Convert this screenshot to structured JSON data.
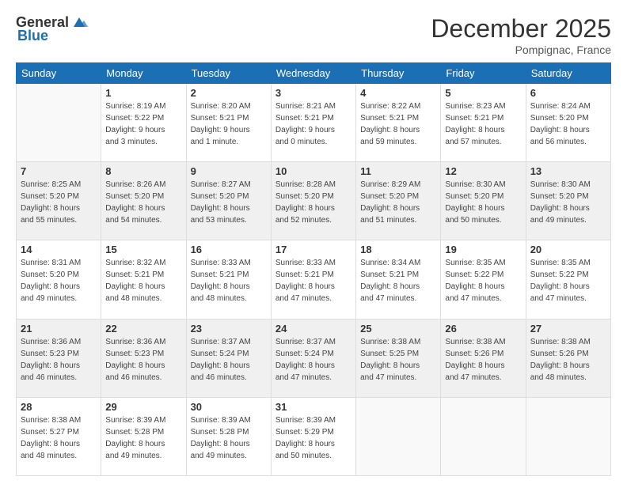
{
  "header": {
    "logo_general": "General",
    "logo_blue": "Blue",
    "month_title": "December 2025",
    "location": "Pompignac, France"
  },
  "days_of_week": [
    "Sunday",
    "Monday",
    "Tuesday",
    "Wednesday",
    "Thursday",
    "Friday",
    "Saturday"
  ],
  "weeks": [
    [
      {
        "day": "",
        "info": ""
      },
      {
        "day": "1",
        "info": "Sunrise: 8:19 AM\nSunset: 5:22 PM\nDaylight: 9 hours\nand 3 minutes."
      },
      {
        "day": "2",
        "info": "Sunrise: 8:20 AM\nSunset: 5:21 PM\nDaylight: 9 hours\nand 1 minute."
      },
      {
        "day": "3",
        "info": "Sunrise: 8:21 AM\nSunset: 5:21 PM\nDaylight: 9 hours\nand 0 minutes."
      },
      {
        "day": "4",
        "info": "Sunrise: 8:22 AM\nSunset: 5:21 PM\nDaylight: 8 hours\nand 59 minutes."
      },
      {
        "day": "5",
        "info": "Sunrise: 8:23 AM\nSunset: 5:21 PM\nDaylight: 8 hours\nand 57 minutes."
      },
      {
        "day": "6",
        "info": "Sunrise: 8:24 AM\nSunset: 5:20 PM\nDaylight: 8 hours\nand 56 minutes."
      }
    ],
    [
      {
        "day": "7",
        "info": "Sunrise: 8:25 AM\nSunset: 5:20 PM\nDaylight: 8 hours\nand 55 minutes."
      },
      {
        "day": "8",
        "info": "Sunrise: 8:26 AM\nSunset: 5:20 PM\nDaylight: 8 hours\nand 54 minutes."
      },
      {
        "day": "9",
        "info": "Sunrise: 8:27 AM\nSunset: 5:20 PM\nDaylight: 8 hours\nand 53 minutes."
      },
      {
        "day": "10",
        "info": "Sunrise: 8:28 AM\nSunset: 5:20 PM\nDaylight: 8 hours\nand 52 minutes."
      },
      {
        "day": "11",
        "info": "Sunrise: 8:29 AM\nSunset: 5:20 PM\nDaylight: 8 hours\nand 51 minutes."
      },
      {
        "day": "12",
        "info": "Sunrise: 8:30 AM\nSunset: 5:20 PM\nDaylight: 8 hours\nand 50 minutes."
      },
      {
        "day": "13",
        "info": "Sunrise: 8:30 AM\nSunset: 5:20 PM\nDaylight: 8 hours\nand 49 minutes."
      }
    ],
    [
      {
        "day": "14",
        "info": "Sunrise: 8:31 AM\nSunset: 5:20 PM\nDaylight: 8 hours\nand 49 minutes."
      },
      {
        "day": "15",
        "info": "Sunrise: 8:32 AM\nSunset: 5:21 PM\nDaylight: 8 hours\nand 48 minutes."
      },
      {
        "day": "16",
        "info": "Sunrise: 8:33 AM\nSunset: 5:21 PM\nDaylight: 8 hours\nand 48 minutes."
      },
      {
        "day": "17",
        "info": "Sunrise: 8:33 AM\nSunset: 5:21 PM\nDaylight: 8 hours\nand 47 minutes."
      },
      {
        "day": "18",
        "info": "Sunrise: 8:34 AM\nSunset: 5:21 PM\nDaylight: 8 hours\nand 47 minutes."
      },
      {
        "day": "19",
        "info": "Sunrise: 8:35 AM\nSunset: 5:22 PM\nDaylight: 8 hours\nand 47 minutes."
      },
      {
        "day": "20",
        "info": "Sunrise: 8:35 AM\nSunset: 5:22 PM\nDaylight: 8 hours\nand 47 minutes."
      }
    ],
    [
      {
        "day": "21",
        "info": "Sunrise: 8:36 AM\nSunset: 5:23 PM\nDaylight: 8 hours\nand 46 minutes."
      },
      {
        "day": "22",
        "info": "Sunrise: 8:36 AM\nSunset: 5:23 PM\nDaylight: 8 hours\nand 46 minutes."
      },
      {
        "day": "23",
        "info": "Sunrise: 8:37 AM\nSunset: 5:24 PM\nDaylight: 8 hours\nand 46 minutes."
      },
      {
        "day": "24",
        "info": "Sunrise: 8:37 AM\nSunset: 5:24 PM\nDaylight: 8 hours\nand 47 minutes."
      },
      {
        "day": "25",
        "info": "Sunrise: 8:38 AM\nSunset: 5:25 PM\nDaylight: 8 hours\nand 47 minutes."
      },
      {
        "day": "26",
        "info": "Sunrise: 8:38 AM\nSunset: 5:26 PM\nDaylight: 8 hours\nand 47 minutes."
      },
      {
        "day": "27",
        "info": "Sunrise: 8:38 AM\nSunset: 5:26 PM\nDaylight: 8 hours\nand 48 minutes."
      }
    ],
    [
      {
        "day": "28",
        "info": "Sunrise: 8:38 AM\nSunset: 5:27 PM\nDaylight: 8 hours\nand 48 minutes."
      },
      {
        "day": "29",
        "info": "Sunrise: 8:39 AM\nSunset: 5:28 PM\nDaylight: 8 hours\nand 49 minutes."
      },
      {
        "day": "30",
        "info": "Sunrise: 8:39 AM\nSunset: 5:28 PM\nDaylight: 8 hours\nand 49 minutes."
      },
      {
        "day": "31",
        "info": "Sunrise: 8:39 AM\nSunset: 5:29 PM\nDaylight: 8 hours\nand 50 minutes."
      },
      {
        "day": "",
        "info": ""
      },
      {
        "day": "",
        "info": ""
      },
      {
        "day": "",
        "info": ""
      }
    ]
  ]
}
